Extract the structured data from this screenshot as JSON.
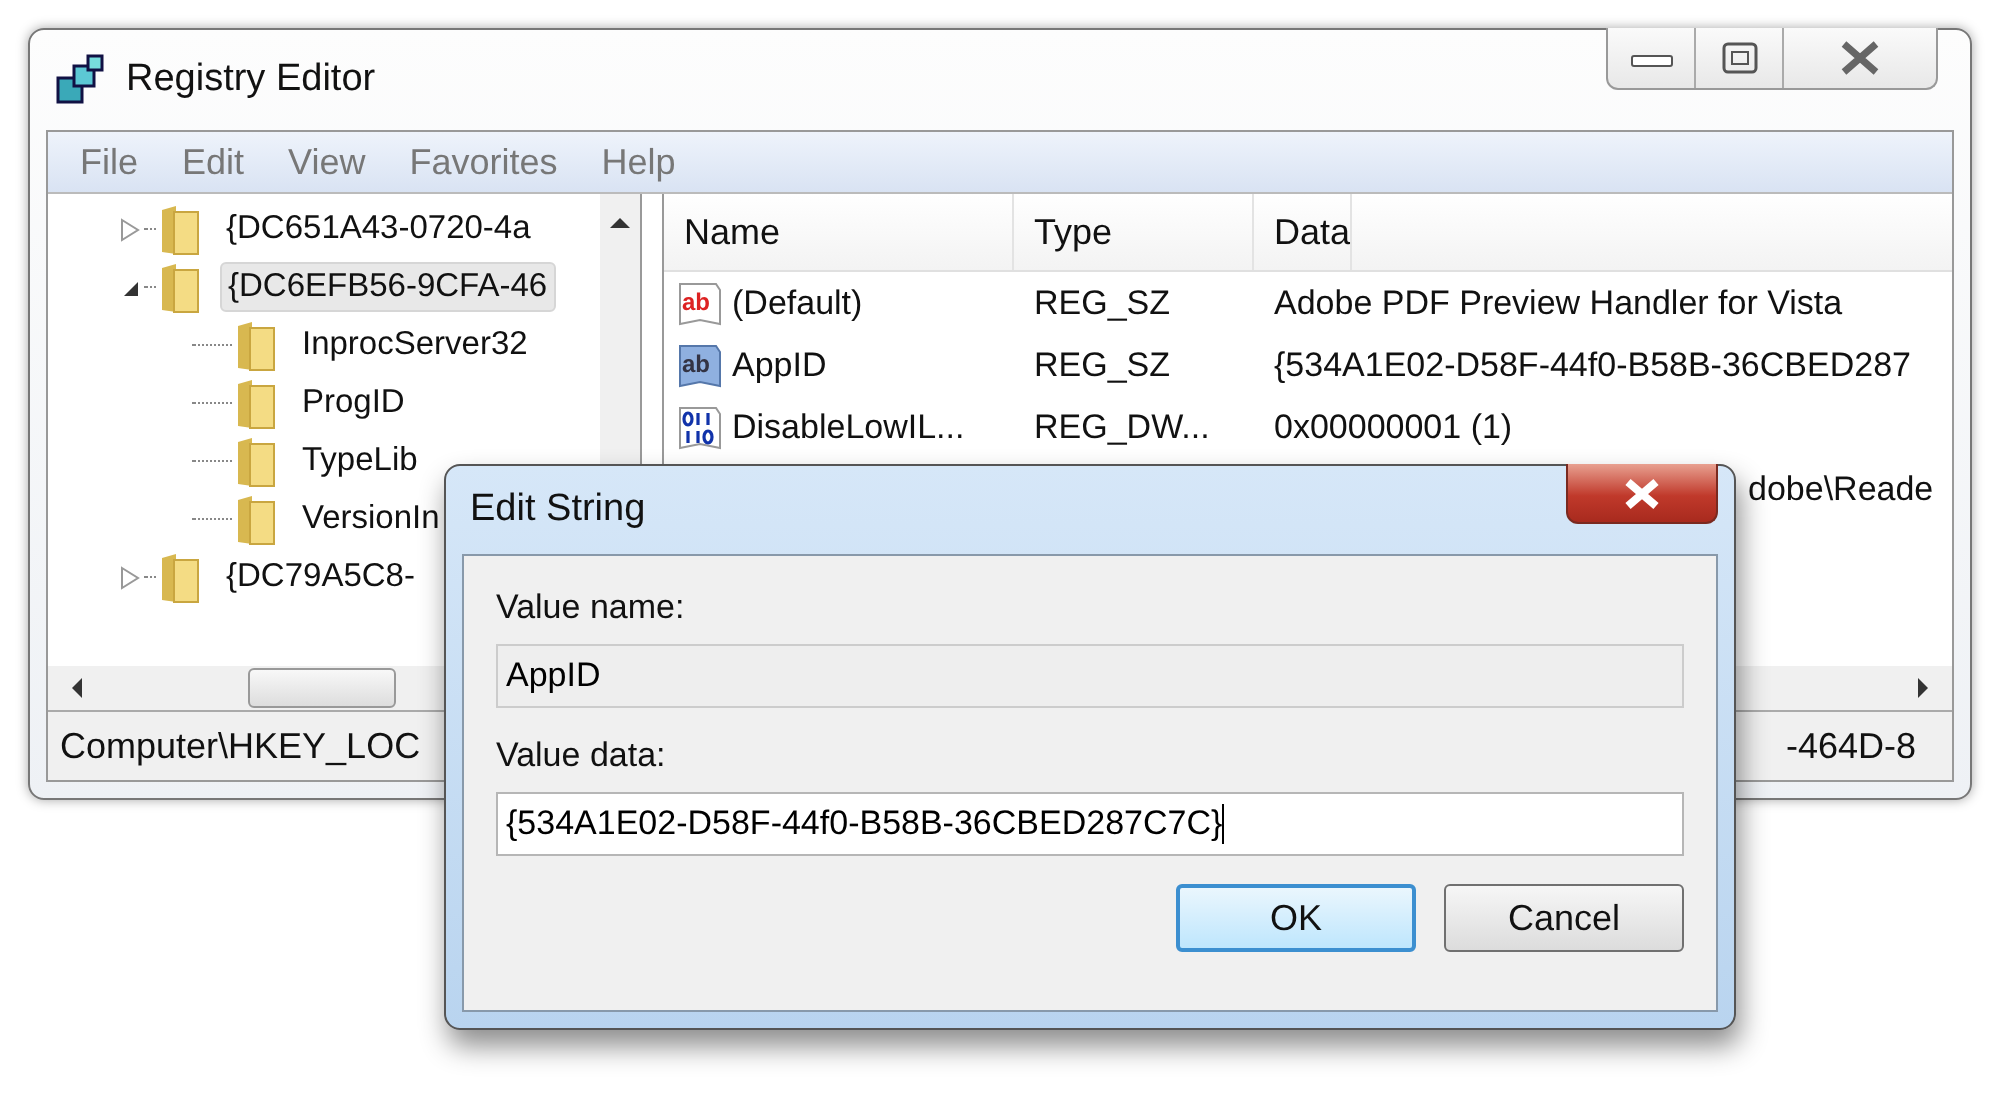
{
  "window": {
    "title": "Registry Editor"
  },
  "menu": [
    {
      "label": "File"
    },
    {
      "label": "Edit"
    },
    {
      "label": "View"
    },
    {
      "label": "Favorites"
    },
    {
      "label": "Help"
    }
  ],
  "tree": [
    {
      "label": "{DC651A43-0720-4a",
      "expanded": false,
      "selected": false
    },
    {
      "label": "{DC6EFB56-9CFA-46",
      "expanded": true,
      "selected": true,
      "children": [
        {
          "label": "InprocServer32",
          "selected": false
        },
        {
          "label": "ProgID",
          "selected": false
        },
        {
          "label": "TypeLib",
          "selected": false
        },
        {
          "label": "VersionIn",
          "selected": false
        }
      ]
    },
    {
      "label": "{DC79A5C8-",
      "expanded": false,
      "selected": false
    }
  ],
  "columns": [
    "Name",
    "Type",
    "Data"
  ],
  "rows": [
    {
      "kind": "default",
      "icon_label": "ab",
      "name": "(Default)",
      "type": "REG_SZ",
      "data": "Adobe PDF Preview Handler for Vista"
    },
    {
      "kind": "string",
      "icon_label": "ab",
      "name": "AppID",
      "type": "REG_SZ",
      "data": "{534A1E02-D58F-44f0-B58B-36CBED287"
    },
    {
      "kind": "dword",
      "name": "DisableLowIL...",
      "type": "REG_DW...",
      "data": "0x00000001 (1)"
    },
    {
      "kind": "covered",
      "data": "dobe\\Reade"
    }
  ],
  "status_bar": {
    "left": "Computer\\HKEY_LOC",
    "right": "-464D-8"
  },
  "dialog": {
    "title": "Edit String",
    "name_label": "Value name:",
    "name_value": "AppID",
    "data_label": "Value data:",
    "data_value": "{534A1E02-D58F-44f0-B58B-36CBED287C7C}",
    "buttons": [
      {
        "label": "OK",
        "default": true
      },
      {
        "label": "Cancel",
        "default": false
      }
    ]
  }
}
